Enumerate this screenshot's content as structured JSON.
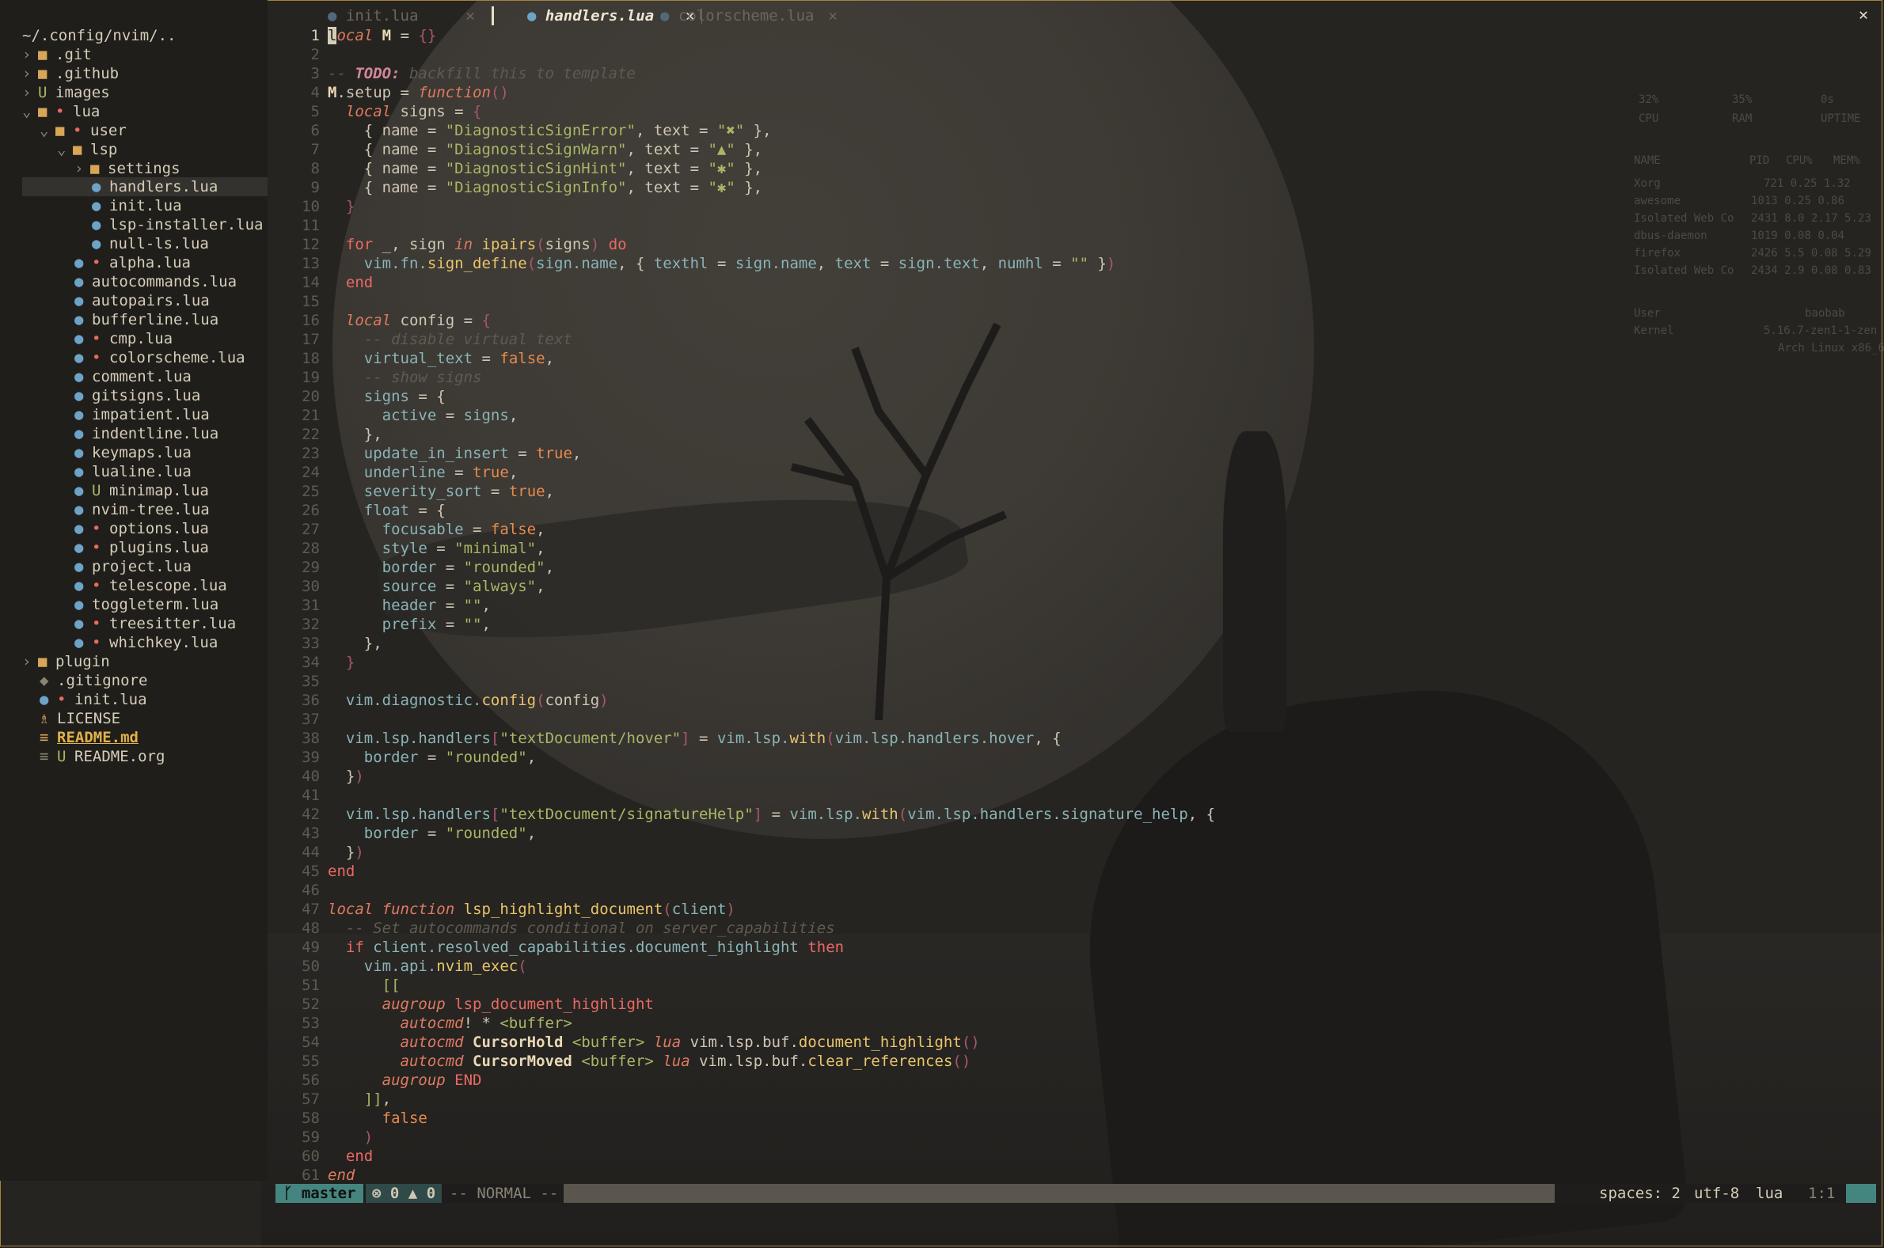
{
  "colors": {
    "accent": "#45857f",
    "keyword": "#e07a5f",
    "string": "#a9b665",
    "function": "#e9c46a",
    "folder": "#d8a657",
    "lua_icon": "#6ea3c8"
  },
  "explorer": {
    "root": "~/.config/nvim/..",
    "items": [
      {
        "name": ".git",
        "type": "folder",
        "chev": "›",
        "icon": "folder-icon",
        "badge": ""
      },
      {
        "name": ".github",
        "type": "folder",
        "chev": "›",
        "icon": "folder-icon",
        "badge": ""
      },
      {
        "name": "images",
        "type": "folder",
        "chev": "›",
        "icon": "folder-icon",
        "badge": "U"
      },
      {
        "name": "lua",
        "type": "folder",
        "chev": "⌄",
        "icon": "folder-open-icon",
        "badge": "•"
      },
      {
        "name": "user",
        "type": "folder",
        "chev": "⌄",
        "icon": "folder-open-icon",
        "badge": "•"
      },
      {
        "name": "lsp",
        "type": "folder",
        "chev": "⌄",
        "icon": "folder-open-icon",
        "badge": ""
      },
      {
        "name": "settings",
        "type": "folder",
        "chev": "›",
        "icon": "folder-icon",
        "badge": ""
      },
      {
        "name": "handlers.lua",
        "type": "lua",
        "badge": ""
      },
      {
        "name": "init.lua",
        "type": "lua",
        "badge": ""
      },
      {
        "name": "lsp-installer.lua",
        "type": "lua",
        "badge": ""
      },
      {
        "name": "null-ls.lua",
        "type": "lua",
        "badge": ""
      },
      {
        "name": "alpha.lua",
        "type": "lua",
        "badge": "•"
      },
      {
        "name": "autocommands.lua",
        "type": "lua",
        "badge": ""
      },
      {
        "name": "autopairs.lua",
        "type": "lua",
        "badge": ""
      },
      {
        "name": "bufferline.lua",
        "type": "lua",
        "badge": ""
      },
      {
        "name": "cmp.lua",
        "type": "lua",
        "badge": "•"
      },
      {
        "name": "colorscheme.lua",
        "type": "lua",
        "badge": "•"
      },
      {
        "name": "comment.lua",
        "type": "lua",
        "badge": ""
      },
      {
        "name": "gitsigns.lua",
        "type": "lua",
        "badge": ""
      },
      {
        "name": "impatient.lua",
        "type": "lua",
        "badge": ""
      },
      {
        "name": "indentline.lua",
        "type": "lua",
        "badge": ""
      },
      {
        "name": "keymaps.lua",
        "type": "lua",
        "badge": ""
      },
      {
        "name": "lualine.lua",
        "type": "lua",
        "badge": ""
      },
      {
        "name": "minimap.lua",
        "type": "lua",
        "badge": "U"
      },
      {
        "name": "nvim-tree.lua",
        "type": "lua",
        "badge": ""
      },
      {
        "name": "options.lua",
        "type": "lua",
        "badge": "•"
      },
      {
        "name": "plugins.lua",
        "type": "lua",
        "badge": "•"
      },
      {
        "name": "project.lua",
        "type": "lua",
        "badge": ""
      },
      {
        "name": "telescope.lua",
        "type": "lua",
        "badge": "•"
      },
      {
        "name": "toggleterm.lua",
        "type": "lua",
        "badge": ""
      },
      {
        "name": "treesitter.lua",
        "type": "lua",
        "badge": "•"
      },
      {
        "name": "whichkey.lua",
        "type": "lua",
        "badge": "•"
      },
      {
        "name": "plugin",
        "type": "folder",
        "chev": "›",
        "icon": "folder-icon",
        "badge": ""
      },
      {
        "name": ".gitignore",
        "type": "file",
        "badge": ""
      },
      {
        "name": "init.lua",
        "type": "lua",
        "badge": "•"
      },
      {
        "name": "LICENSE",
        "type": "license",
        "badge": ""
      },
      {
        "name": "README.md",
        "type": "readme",
        "badge": ""
      },
      {
        "name": "README.org",
        "type": "file",
        "badge": "U"
      }
    ]
  },
  "tabs": [
    {
      "label": "init.lua",
      "close": "✕",
      "active": false
    },
    {
      "label": "handlers.lua",
      "close": "✕",
      "active": true
    },
    {
      "label": "colorscheme.lua",
      "close": "✕",
      "active": false
    }
  ],
  "editor": {
    "line_numbers": [
      "1",
      "2",
      "3",
      "4",
      "5",
      "6",
      "7",
      "8",
      "9",
      "10",
      "11",
      "12",
      "13",
      "14",
      "15",
      "16",
      "17",
      "18",
      "19",
      "20",
      "21",
      "22",
      "23",
      "24",
      "25",
      "26",
      "27",
      "28",
      "29",
      "30",
      "31",
      "32",
      "33",
      "34",
      "35",
      "36",
      "37",
      "38",
      "39",
      "40",
      "41",
      "42",
      "43",
      "44",
      "45",
      "46",
      "47",
      "48",
      "49",
      "50",
      "51",
      "52",
      "53",
      "54",
      "55",
      "56",
      "57",
      "58",
      "59",
      "60",
      "61"
    ]
  },
  "monitor": {
    "gauges": [
      "32%",
      "35%",
      "0s"
    ],
    "gauge_labels": [
      "CPU",
      "RAM",
      "UPTIME"
    ],
    "header": [
      "NAME",
      "PID",
      "CPU%",
      "MEM%"
    ],
    "procs": [
      [
        "Xorg",
        "721",
        "0.25",
        "1.32"
      ],
      [
        "awesome",
        "1013",
        "0.25",
        "0.86"
      ],
      [
        "Isolated Web Co",
        "2431",
        "8.0",
        "2.17 5.23"
      ],
      [
        "dbus-daemon",
        "1019",
        "0.08",
        "0.04"
      ],
      [
        "firefox",
        "2426",
        "5.5",
        "0.08 5.29"
      ],
      [
        "Isolated Web Co",
        "2434",
        "2.9",
        "0.08 0.83"
      ]
    ],
    "user_label": "User",
    "user_value": "baobab",
    "kernel_label": "Kernel",
    "kernel_value": "5.16.7-zen1-1-zen",
    "distro": "Arch Linux x86_64"
  },
  "statusline": {
    "branch_icon": "",
    "branch": "master",
    "errors": "0",
    "warnings": "0",
    "mode": "-- NORMAL --",
    "spaces": "spaces: 2",
    "encoding": "utf-8",
    "filetype": "lua",
    "position": "1:1"
  }
}
